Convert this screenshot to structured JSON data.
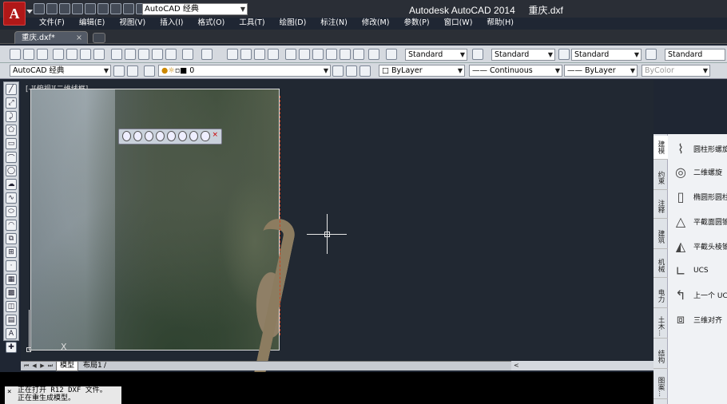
{
  "app": {
    "logo": "A",
    "title": "Autodesk AutoCAD 2014",
    "filename": "重庆.dxf",
    "workspace": "AutoCAD 经典"
  },
  "menu": [
    "文件(F)",
    "编辑(E)",
    "视图(V)",
    "插入(I)",
    "格式(O)",
    "工具(T)",
    "绘图(D)",
    "标注(N)",
    "修改(M)",
    "参数(P)",
    "窗口(W)",
    "帮助(H)"
  ],
  "doc_tab": {
    "label": "重庆.dxf*",
    "close": "×"
  },
  "styles": {
    "text_style": "Standard",
    "dim_style": "Standard",
    "table_style": "Standard",
    "multileader_style": "Standard"
  },
  "properties": {
    "workspace2": "AutoCAD 经典",
    "layer": "0",
    "color": "ByLayer",
    "linetype": "Continuous",
    "lineweight": "ByLayer",
    "plotstyle": "ByColor"
  },
  "viewport_label": "[-][俯视][二维线框]",
  "ucs_x": "X",
  "layout_tabs": {
    "model": "模型",
    "layout1": "布局1",
    "sep": "/",
    "scroll_arrow": "<"
  },
  "command_lines": [
    "正在打开 R12 DXF 文件。",
    "正在重生成模型。"
  ],
  "command_close": "×",
  "palette": {
    "tabs": [
      "建模",
      "约束",
      "注释",
      "建筑",
      "机械",
      "电力",
      "土木...",
      "结构",
      "图案..."
    ],
    "items": [
      "圆柱形螺旋",
      "二维螺旋",
      "椭圆形圆柱",
      "平截面圆锥",
      "平截头棱锥",
      "UCS",
      "上一个 UCS",
      "三维对齐"
    ]
  },
  "colors": {
    "accent": "#b01818",
    "canvas": "#212832",
    "toolbar": "#d5d9df"
  }
}
